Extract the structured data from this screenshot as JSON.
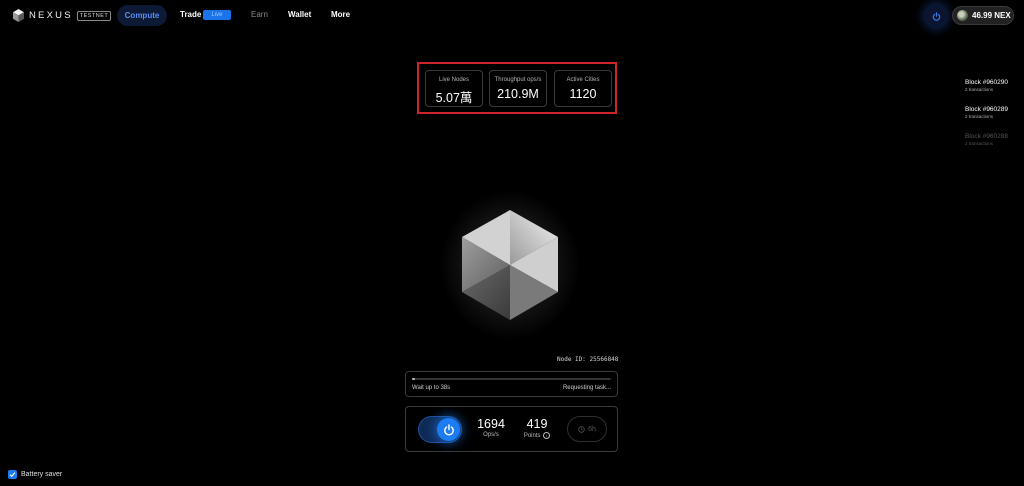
{
  "brand": {
    "name": "NEXUS",
    "badge": "TESTNET"
  },
  "nav": {
    "compute": "Compute",
    "trade": "Trade",
    "trade_badge": "Live",
    "earn": "Earn",
    "wallet": "Wallet",
    "more": "More"
  },
  "balance": {
    "amount": "46.99 NEX"
  },
  "stats": [
    {
      "label": "Live Nodes",
      "value": "5.07萬"
    },
    {
      "label": "Throughput ops/s",
      "value": "210.9M"
    },
    {
      "label": "Active Cities",
      "value": "1120"
    }
  ],
  "blocks": [
    {
      "title": "Block #960290",
      "sub": "2 transactions"
    },
    {
      "title": "Block #960289",
      "sub": "2 transactions"
    },
    {
      "title": "Block #960288",
      "sub": "2 transactions"
    }
  ],
  "node": {
    "id_text": "Node ID: 25566848"
  },
  "progress": {
    "left": "Wait up to 38s",
    "right": "Requesting task...",
    "fraction": 0.01
  },
  "control": {
    "ops_value": "1694",
    "ops_label": "Ops/s",
    "points_value": "419",
    "points_label": "Points",
    "timer": "6h"
  },
  "battery": {
    "label": "Battery saver",
    "checked": true
  },
  "colors": {
    "accent": "#1e7cf2",
    "highlight_frame": "#d0242b",
    "background": "#000000"
  }
}
